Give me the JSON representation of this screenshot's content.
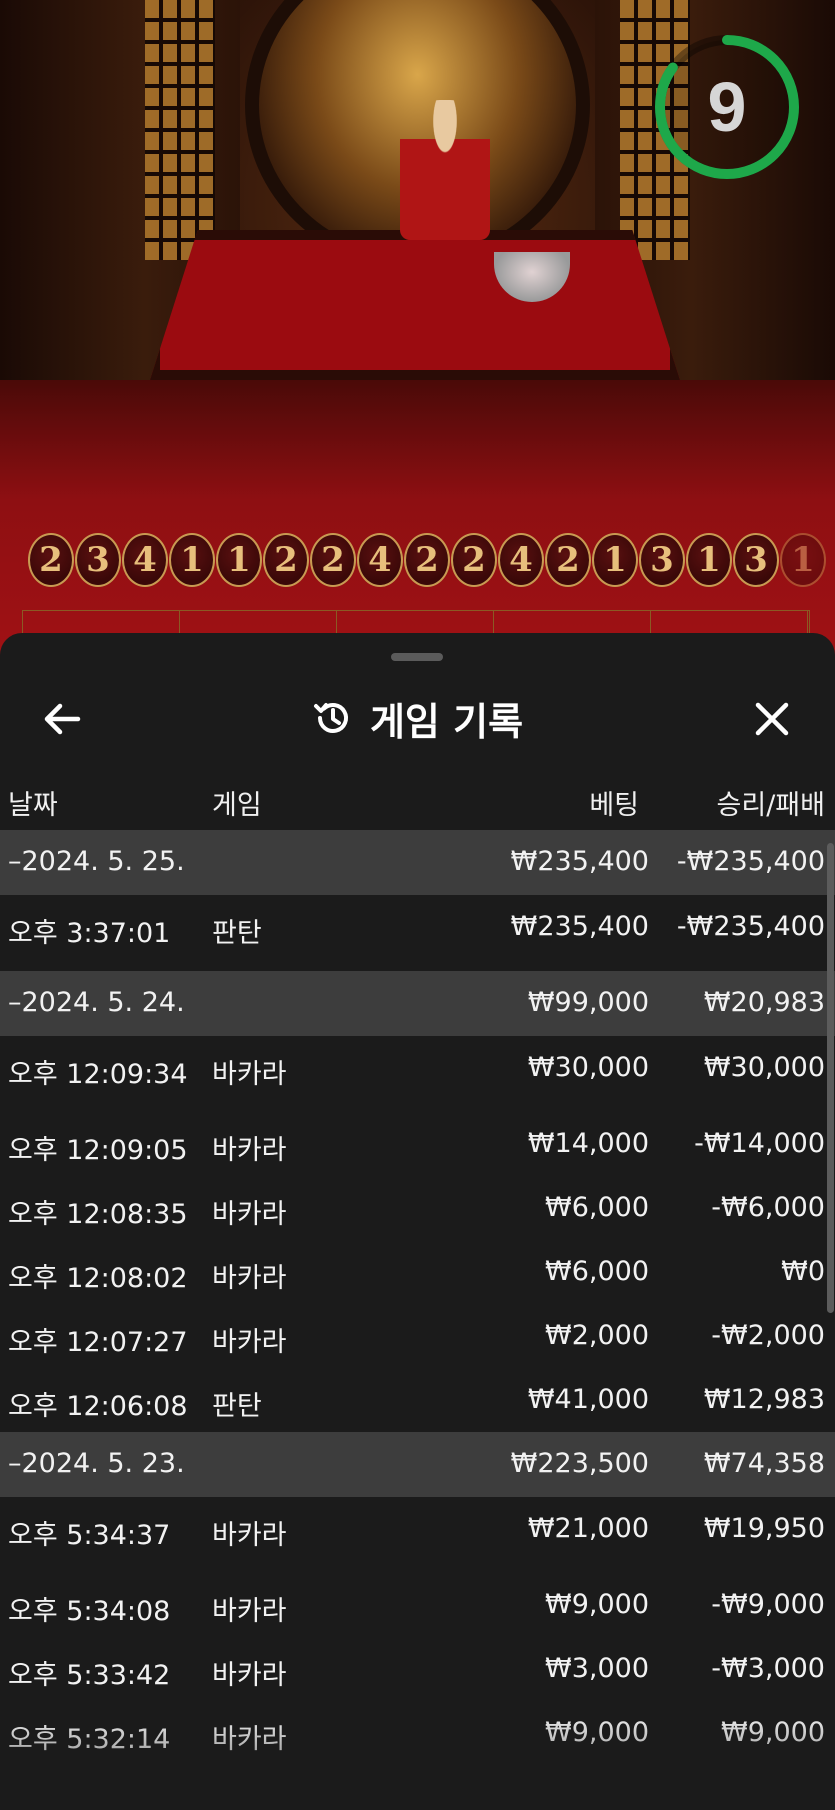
{
  "timer": {
    "value": "9",
    "fraction_remaining": 0.85,
    "color": "#1ea84a"
  },
  "road": {
    "balls": [
      "2",
      "3",
      "4",
      "1",
      "1",
      "2",
      "2",
      "4",
      "2",
      "2",
      "4",
      "2",
      "1",
      "3",
      "1",
      "3",
      "1"
    ]
  },
  "sheet": {
    "title": "게임 기록",
    "back_icon": "arrow-left-icon",
    "history_icon": "history-clock-icon",
    "close_icon": "close-icon",
    "columns": {
      "date": "날짜",
      "game": "게임",
      "bet": "베팅",
      "result": "승리/패배"
    },
    "rows": [
      {
        "type": "date",
        "date": "–2024. 5. 25.",
        "game": "",
        "bet": "₩235,400",
        "result": "-₩235,400"
      },
      {
        "type": "item",
        "date": "오후 3:37:01",
        "game": "판탄",
        "bet": "₩235,400",
        "result": "-₩235,400"
      },
      {
        "type": "date",
        "date": "–2024. 5. 24.",
        "game": "",
        "bet": "₩99,000",
        "result": "₩20,983"
      },
      {
        "type": "item",
        "date": "오후 12:09:34",
        "game": "바카라",
        "bet": "₩30,000",
        "result": "₩30,000"
      },
      {
        "type": "item",
        "date": "오후 12:09:05",
        "game": "바카라",
        "bet": "₩14,000",
        "result": "-₩14,000"
      },
      {
        "type": "item",
        "date": "오후 12:08:35",
        "game": "바카라",
        "bet": "₩6,000",
        "result": "-₩6,000"
      },
      {
        "type": "item",
        "date": "오후 12:08:02",
        "game": "바카라",
        "bet": "₩6,000",
        "result": "₩0"
      },
      {
        "type": "item",
        "date": "오후 12:07:27",
        "game": "바카라",
        "bet": "₩2,000",
        "result": "-₩2,000"
      },
      {
        "type": "item",
        "date": "오후 12:06:08",
        "game": "판탄",
        "bet": "₩41,000",
        "result": "₩12,983"
      },
      {
        "type": "date",
        "date": "–2024. 5. 23.",
        "game": "",
        "bet": "₩223,500",
        "result": "₩74,358"
      },
      {
        "type": "item",
        "date": "오후 5:34:37",
        "game": "바카라",
        "bet": "₩21,000",
        "result": "₩19,950"
      },
      {
        "type": "item",
        "date": "오후 5:34:08",
        "game": "바카라",
        "bet": "₩9,000",
        "result": "-₩9,000"
      },
      {
        "type": "item",
        "date": "오후 5:33:42",
        "game": "바카라",
        "bet": "₩3,000",
        "result": "-₩3,000"
      },
      {
        "type": "item",
        "date": "오후 5:32:14",
        "game": "바카라",
        "bet": "₩9,000",
        "result": "₩9,000"
      }
    ]
  }
}
